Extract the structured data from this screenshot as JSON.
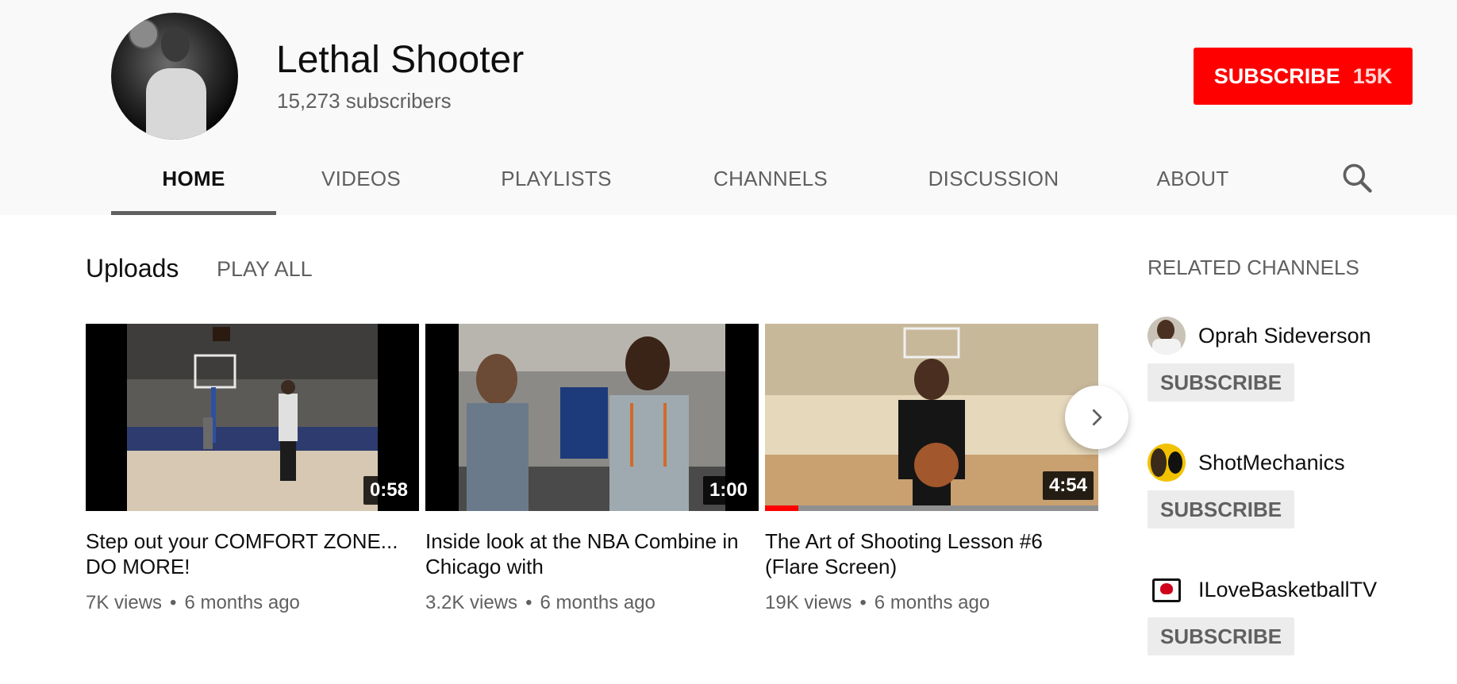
{
  "channel": {
    "name": "Lethal Shooter",
    "subscribers": "15,273 subscribers",
    "subscribe_label": "SUBSCRIBE",
    "subscribe_count": "15K"
  },
  "tabs": [
    {
      "label": "HOME",
      "active": true
    },
    {
      "label": "VIDEOS"
    },
    {
      "label": "PLAYLISTS"
    },
    {
      "label": "CHANNELS"
    },
    {
      "label": "DISCUSSION"
    },
    {
      "label": "ABOUT"
    }
  ],
  "uploads": {
    "title": "Uploads",
    "play_all": "PLAY ALL",
    "videos": [
      {
        "title": "Step out your COMFORT ZONE... DO MORE!",
        "duration": "0:58",
        "views": "7K views",
        "age": "6 months ago"
      },
      {
        "title": "Inside look at the NBA Combine in Chicago with",
        "duration": "1:00",
        "views": "3.2K views",
        "age": "6 months ago"
      },
      {
        "title": "The Art of Shooting Lesson #6 (Flare Screen)",
        "duration": "4:54",
        "views": "19K views",
        "age": "6 months ago",
        "watched_fraction": 0.1
      }
    ],
    "meta_separator": "•"
  },
  "related": {
    "title": "RELATED CHANNELS",
    "subscribe_label": "SUBSCRIBE",
    "channels": [
      {
        "name": "Oprah Sideverson"
      },
      {
        "name": "ShotMechanics"
      },
      {
        "name": "ILoveBasketballTV"
      }
    ]
  },
  "colors": {
    "subscribe_red": "#ff0000",
    "header_bg": "#f9f9f9",
    "secondary_text": "#606060"
  },
  "icons": {
    "search": "search-icon",
    "next": "chevron-right-icon"
  }
}
